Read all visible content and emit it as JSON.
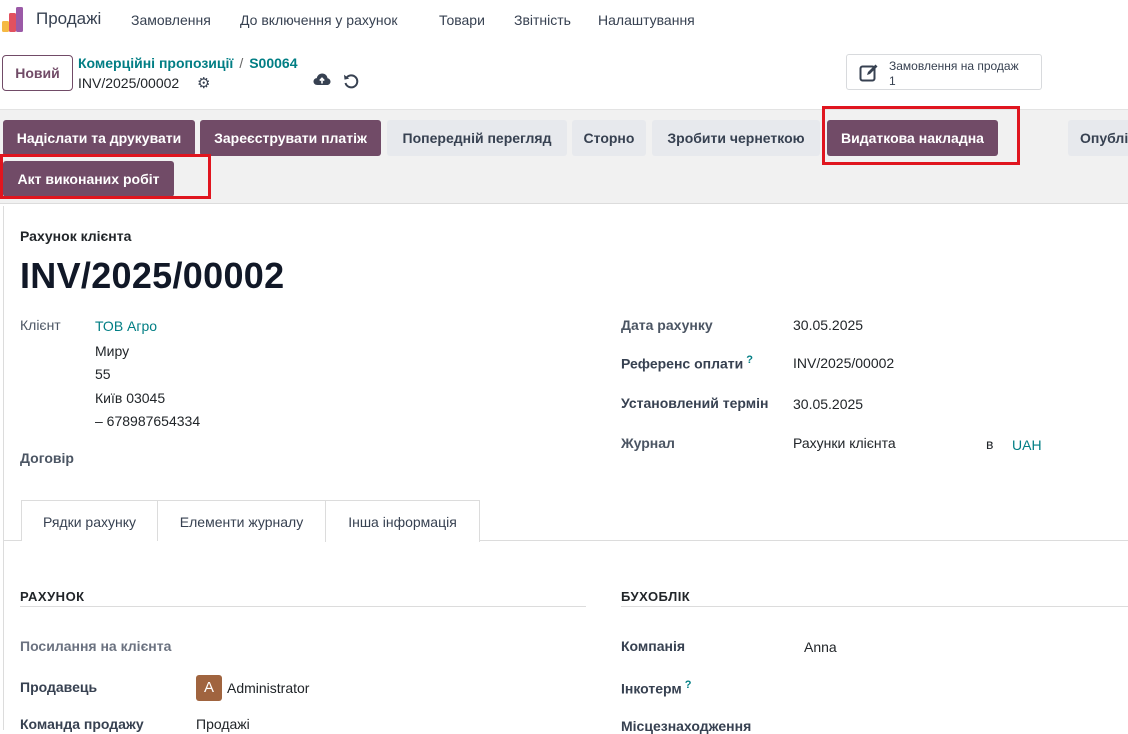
{
  "navbar": {
    "app_title": "Продажі",
    "menu": [
      "Замовлення",
      "До включення у рахунок",
      "Товари",
      "Звітність",
      "Налаштування"
    ]
  },
  "control": {
    "new_button": "Новий",
    "breadcrumb": [
      "Комерційні пропозиції",
      "S00064"
    ],
    "breadcrumb_sep": "/",
    "record_name": "INV/2025/00002",
    "smart_button": {
      "label": "Замовлення на продаж",
      "count": "1"
    }
  },
  "actions": {
    "send_print": "Надіслати та друкувати",
    "register_payment": "Зареєструвати платіж",
    "preview": "Попередній перегляд",
    "reverse": "Сторно",
    "reset_draft": "Зробити чернеткою",
    "delivery_note": "Видаткова накладна",
    "publish": "Опублі",
    "act": "Акт виконаних робіт"
  },
  "form": {
    "doc_type": "Рахунок клієнта",
    "doc_number": "INV/2025/00002",
    "customer_label": "Клієнт",
    "customer_name": "ТОВ Агро",
    "customer_address": [
      "Миру",
      "55",
      "Київ 03045",
      "– 678987654334"
    ],
    "contract_label": "Договір",
    "invoice_date_label": "Дата рахунку",
    "invoice_date": "30.05.2025",
    "payment_ref_label": "Референс оплати",
    "payment_ref_help": "?",
    "payment_ref": "INV/2025/00002",
    "due_label": "Установлений термін",
    "due_date": "30.05.2025",
    "journal_label": "Журнал",
    "journal": "Рахунки клієнта",
    "in_label": "в",
    "currency": "UAH"
  },
  "tabs": [
    "Рядки рахунку",
    "Елементи журналу",
    "Інша інформація"
  ],
  "other_info": {
    "invoice_section": "РАХУНОК",
    "customer_ref_label": "Посилання на клієнта",
    "salesperson_label": "Продавець",
    "salesperson_initial": "A",
    "salesperson": "Administrator",
    "team_label": "Команда продажу",
    "team": "Продажі",
    "accounting_section": "БУХОБЛІК",
    "company_label": "Компанія",
    "company": "Anna",
    "incoterm_label": "Інкотерм",
    "incoterm_help": "?",
    "location_label": "Місцезнаходження"
  },
  "colors": {
    "primary": "#714b67",
    "link": "#017e84",
    "highlight": "#e0151f"
  }
}
